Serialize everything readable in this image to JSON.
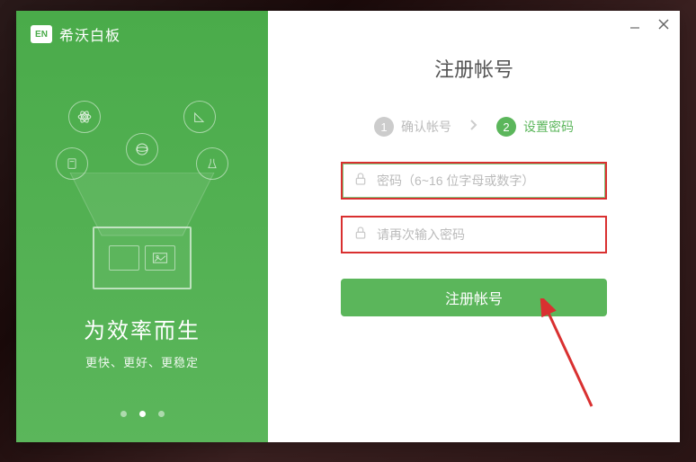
{
  "brand": {
    "logo_text": "EN",
    "name": "希沃白板"
  },
  "left": {
    "tagline_main": "为效率而生",
    "tagline_sub": "更快、更好、更稳定",
    "active_dot": 1
  },
  "form": {
    "title": "注册帐号",
    "steps": {
      "step1_num": "1",
      "step1_label": "确认帐号",
      "step2_num": "2",
      "step2_label": "设置密码"
    },
    "password_placeholder": "密码（6~16 位字母或数字）",
    "confirm_placeholder": "请再次输入密码",
    "submit_label": "注册帐号"
  },
  "colors": {
    "accent": "#5bb65b",
    "highlight_border": "#d93030"
  }
}
